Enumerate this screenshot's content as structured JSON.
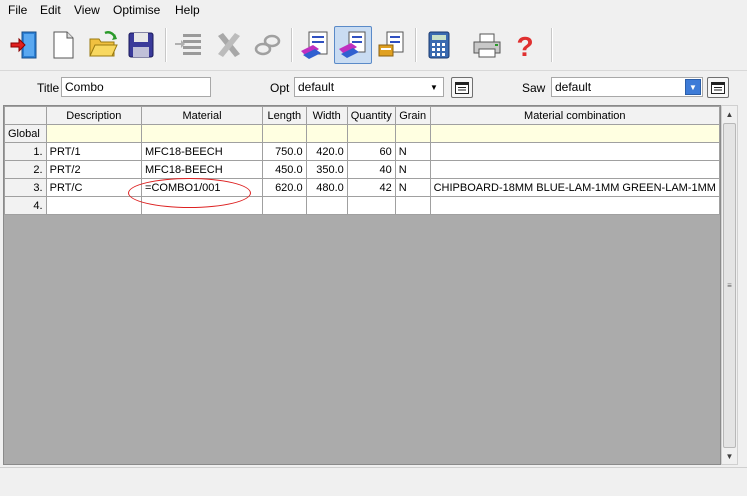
{
  "menu": [
    "File",
    "Edit",
    "View",
    "Optimise",
    "Help"
  ],
  "toolbar": {
    "buttons": [
      {
        "icon": "exit-door-icon"
      },
      {
        "icon": "new-document-icon"
      },
      {
        "icon": "open-folder-icon"
      },
      {
        "icon": "save-disk-icon"
      },
      {
        "icon": "insert-rows-icon"
      },
      {
        "icon": "delete-x-icon"
      },
      {
        "icon": "find-chain-icon"
      },
      {
        "icon": "parts-list-icon"
      },
      {
        "icon": "material-combination-icon"
      },
      {
        "icon": "board-list-icon"
      },
      {
        "icon": "calculator-icon"
      },
      {
        "icon": "printer-icon"
      },
      {
        "icon": "help-question-icon"
      }
    ],
    "active_index": 8
  },
  "options": {
    "title_label": "Title",
    "title_value": "Combo",
    "opt_label": "Opt",
    "opt_value": "default",
    "saw_label": "Saw",
    "saw_value": "default"
  },
  "grid": {
    "headers": [
      "",
      "Description",
      "Material",
      "Length",
      "Width",
      "Quantity",
      "Grain",
      "Material combination"
    ],
    "global_label": "Global",
    "rows": [
      {
        "num": "1.",
        "description": "PRT/1",
        "material": "MFC18-BEECH",
        "length": "750.0",
        "width": "420.0",
        "quantity": "60",
        "grain": "N",
        "combination": ""
      },
      {
        "num": "2.",
        "description": "PRT/2",
        "material": "MFC18-BEECH",
        "length": "450.0",
        "width": "350.0",
        "quantity": "40",
        "grain": "N",
        "combination": ""
      },
      {
        "num": "3.",
        "description": "PRT/C",
        "material": "=COMBO1/001",
        "length": "620.0",
        "width": "480.0",
        "quantity": "42",
        "grain": "N",
        "combination": "CHIPBOARD-18MM BLUE-LAM-1MM GREEN-LAM-1MM"
      },
      {
        "num": "4.",
        "description": "",
        "material": "",
        "length": "",
        "width": "",
        "quantity": "",
        "grain": "",
        "combination": ""
      }
    ]
  },
  "colors": {
    "highlight_ellipse": "#dd2222",
    "global_row": "#ffffe1",
    "active_button": "#c9dcf2"
  }
}
